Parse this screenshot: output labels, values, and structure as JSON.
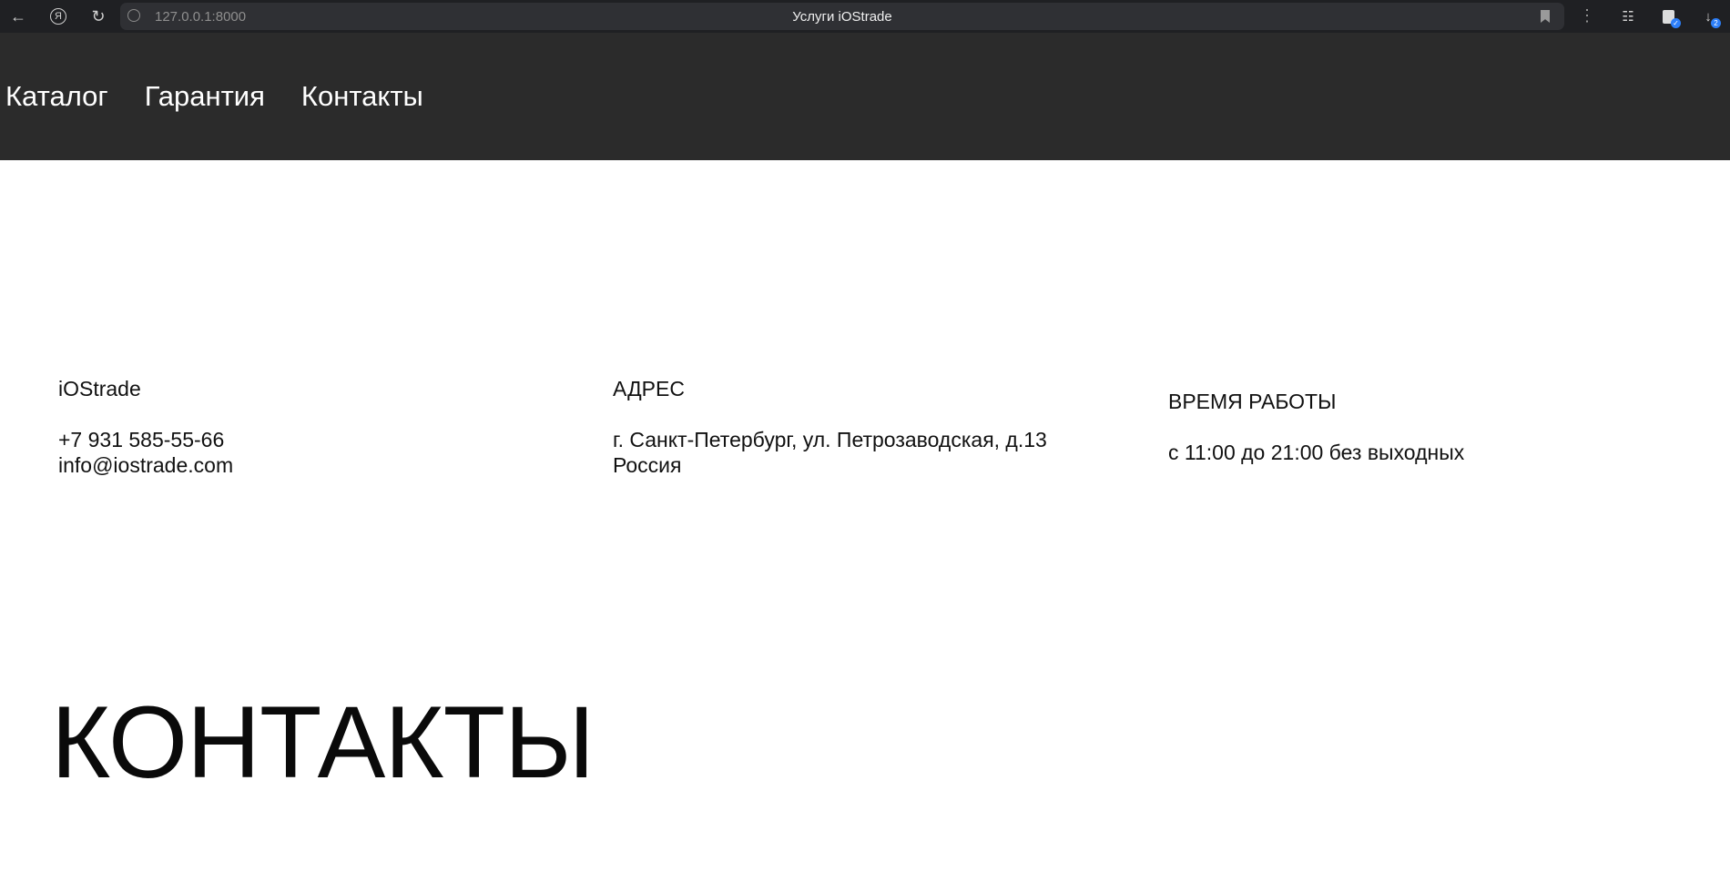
{
  "browser": {
    "url": "127.0.0.1:8000",
    "tab_title": "Услуги iOStrade",
    "download_badge": "2"
  },
  "nav": {
    "items": [
      {
        "label": "Каталог"
      },
      {
        "label": "Гарантия"
      },
      {
        "label": "Контакты"
      }
    ]
  },
  "contacts": {
    "company": {
      "name": "iOStrade",
      "phone": "+7 931 585-55-66",
      "email": "info@iostrade.com"
    },
    "address": {
      "heading": "АДРЕС",
      "line1": "г. Санкт-Петербург, ул. Петрозаводская, д.13",
      "line2": "Россия"
    },
    "hours": {
      "heading": "ВРЕМЯ РАБОТЫ",
      "value": "с 11:00 до 21:00 без выходных"
    }
  },
  "page": {
    "heading": "КОНТАКТЫ"
  },
  "colors": {
    "header_bg": "#2b2b2b",
    "browser_bg": "#1f2023",
    "text": "#111111"
  }
}
